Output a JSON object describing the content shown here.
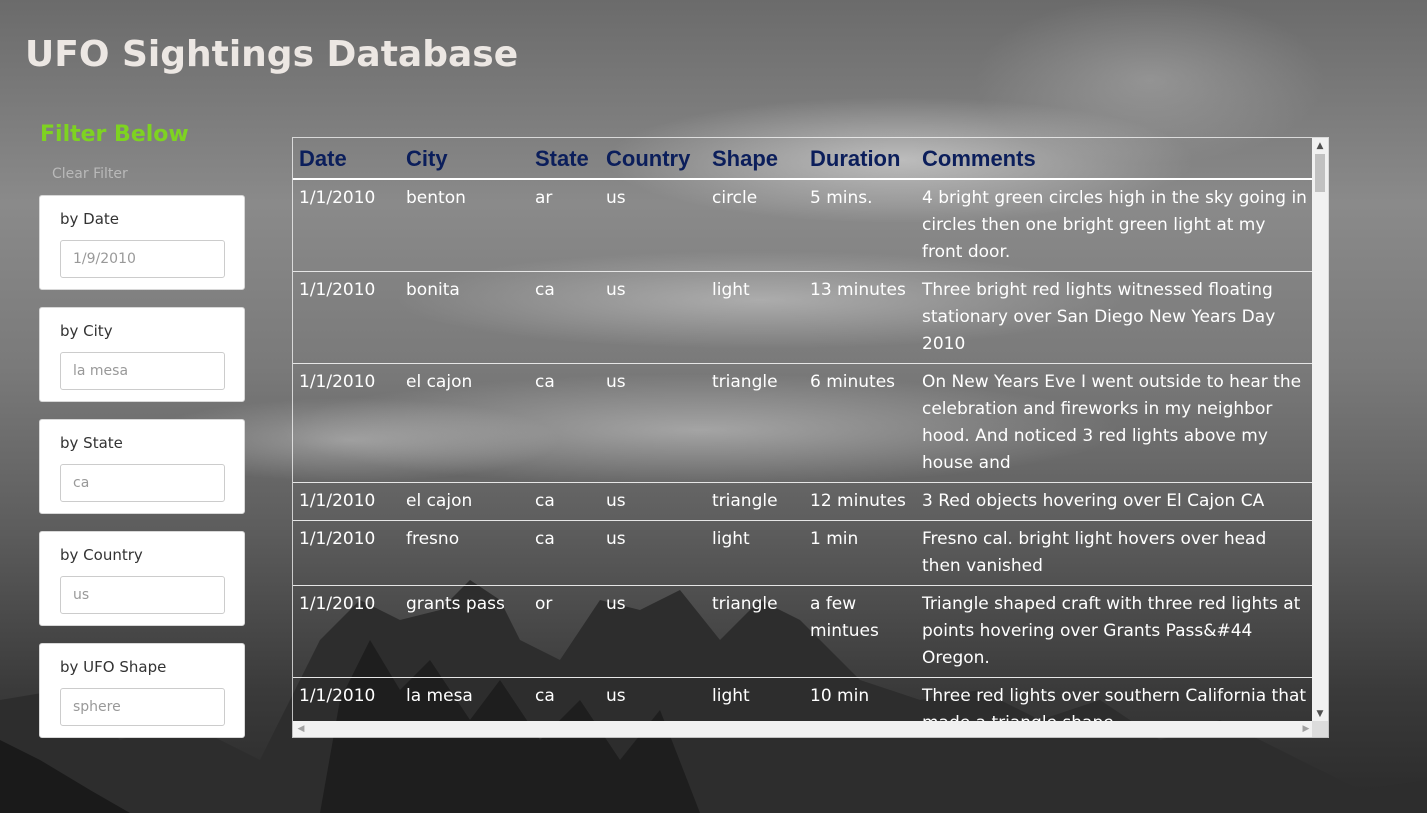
{
  "page_title": "UFO Sightings Database",
  "filters": {
    "heading": "Filter Below",
    "clear_label": "Clear Filter",
    "items": [
      {
        "label": "by Date",
        "placeholder": "1/9/2010"
      },
      {
        "label": "by City",
        "placeholder": "la mesa"
      },
      {
        "label": "by State",
        "placeholder": "ca"
      },
      {
        "label": "by Country",
        "placeholder": "us"
      },
      {
        "label": "by UFO Shape",
        "placeholder": "sphere"
      }
    ]
  },
  "table": {
    "headers": [
      "Date",
      "City",
      "State",
      "Country",
      "Shape",
      "Duration",
      "Comments"
    ],
    "rows": [
      [
        "1/1/2010",
        "benton",
        "ar",
        "us",
        "circle",
        "5 mins.",
        "4 bright green circles high in the sky going in circles then one bright green light at my front door."
      ],
      [
        "1/1/2010",
        "bonita",
        "ca",
        "us",
        "light",
        "13 minutes",
        "Three bright red lights witnessed floating stationary over San Diego New Years Day 2010"
      ],
      [
        "1/1/2010",
        "el cajon",
        "ca",
        "us",
        "triangle",
        "6 minutes",
        "On New Years Eve I went outside to hear the celebration and fireworks in my neighbor hood. And noticed 3 red lights above my house and"
      ],
      [
        "1/1/2010",
        "el cajon",
        "ca",
        "us",
        "triangle",
        "12 minutes",
        "3 Red objects hovering over El Cajon CA"
      ],
      [
        "1/1/2010",
        "fresno",
        "ca",
        "us",
        "light",
        "1 min",
        "Fresno cal. bright light hovers over head then vanished"
      ],
      [
        "1/1/2010",
        "grants pass",
        "or",
        "us",
        "triangle",
        "a few mintues",
        "Triangle shaped craft with three red lights at points hovering over Grants Pass&#44 Oregon."
      ],
      [
        "1/1/2010",
        "la mesa",
        "ca",
        "us",
        "light",
        "10 min",
        "Three red lights over southern California that made a triangle shape"
      ]
    ]
  },
  "colors": {
    "title": "#ece7e3",
    "filter_heading": "#7ed321",
    "table_header": "#0b1e5b",
    "table_text": "#ffffff"
  }
}
